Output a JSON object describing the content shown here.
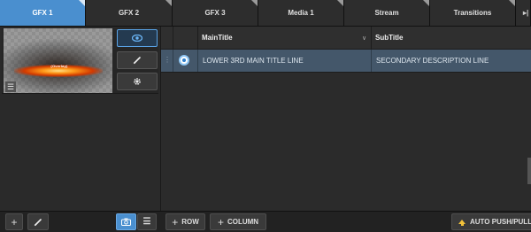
{
  "tabs": [
    {
      "label": "GFX 1",
      "active": true
    },
    {
      "label": "GFX 2",
      "active": false
    },
    {
      "label": "GFX 3",
      "active": false
    },
    {
      "label": "Media 1",
      "active": false
    },
    {
      "label": "Stream",
      "active": false
    },
    {
      "label": "Transitions",
      "active": false
    }
  ],
  "tabs_more_icon": "▸|",
  "thumbnail": {
    "glow_text": "(Overlay)",
    "list_icon": "list-icon"
  },
  "side_buttons": [
    {
      "name": "preview-eye-button",
      "icon": "eye-icon",
      "active": true
    },
    {
      "name": "edit-button",
      "icon": "pencil-icon",
      "active": false
    },
    {
      "name": "settings-button",
      "icon": "gear-icon",
      "active": false
    }
  ],
  "grid": {
    "columns": [
      "MainTitle",
      "SubTitle"
    ],
    "sort_indicator": "∨",
    "rows": [
      {
        "selected": true,
        "cells": [
          "LOWER 3RD MAIN TITLE LINE",
          "SECONDARY DESCRIPTION LINE"
        ]
      }
    ]
  },
  "bottom": {
    "add_icon": "+",
    "add_row_label": "ROW",
    "add_column_label": "COLUMN",
    "auto_push_label": "AUTO PUSH/PULL"
  },
  "colors": {
    "accent": "#4a8fcf",
    "selected_row": "#44576a",
    "auto_push_arrow": "#f2c23a"
  }
}
